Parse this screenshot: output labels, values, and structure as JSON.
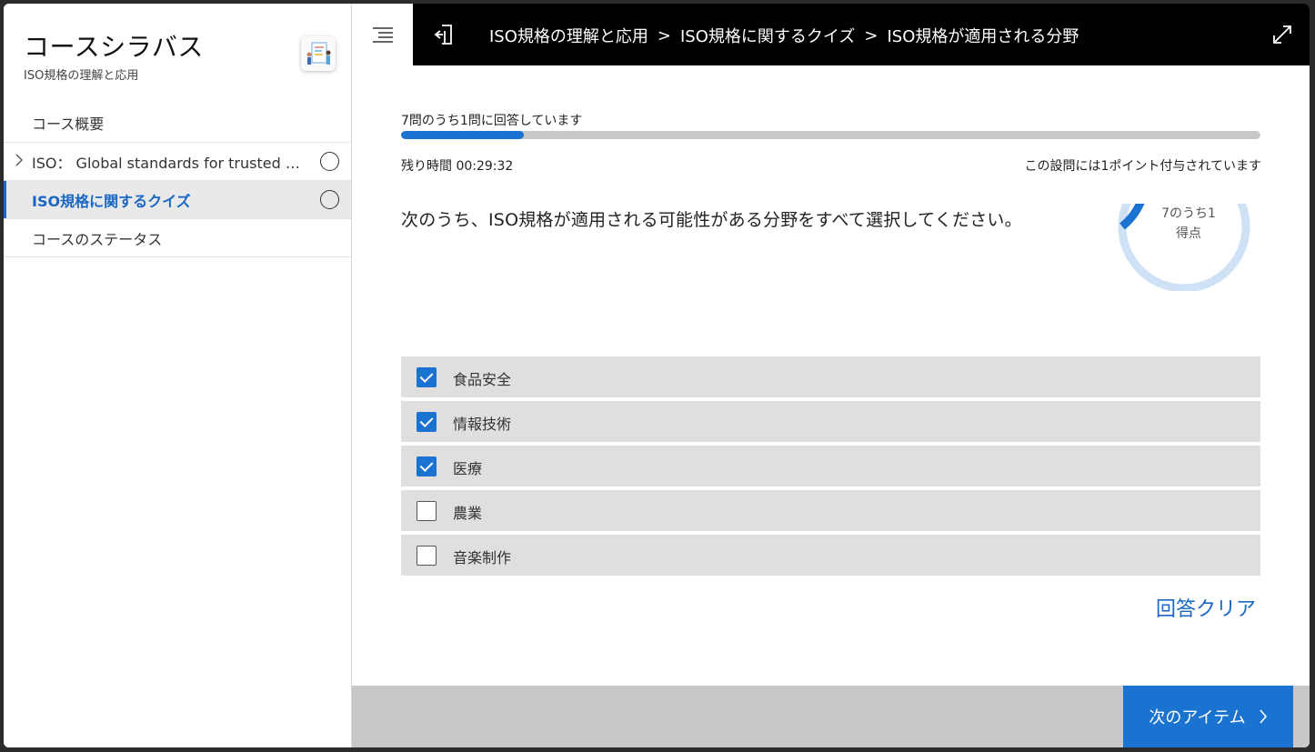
{
  "sidebar": {
    "title": "コースシラバス",
    "subtitle": "ISO規格の理解と応用",
    "thumbnail_icon": "course-illustration-icon",
    "items": [
      {
        "label": "コース概要",
        "has_chevron": false,
        "has_status": false,
        "active": false
      },
      {
        "label": "ISO： Global standards for trusted goods and services",
        "has_chevron": true,
        "has_status": true,
        "active": false
      },
      {
        "label": "ISO規格に関するクイズ",
        "has_chevron": false,
        "has_status": true,
        "active": true
      },
      {
        "label": "コースのステータス",
        "has_chevron": false,
        "has_status": false,
        "active": false
      }
    ]
  },
  "topbar": {
    "menu_icon": "hamburger-menu-icon",
    "exit_icon": "exit-door-icon",
    "breadcrumbs": [
      "ISO規格の理解と応用",
      "ISO規格に関するクイズ",
      "ISO規格が適用される分野"
    ],
    "separator": ">",
    "expand_icon": "expand-icon"
  },
  "quiz": {
    "progress_label": "7問のうち1問に回答しています",
    "progress_fraction": 0.143,
    "time_left": "残り時間 00:29:32",
    "points_note": "この設問には1ポイント付与されています",
    "question": "次のうち、ISO規格が適用される可能性がある分野をすべて選択してください。",
    "score": {
      "line1": "7のうち1",
      "line2": "得点",
      "fraction": 0.143
    },
    "options": [
      {
        "label": "食品安全",
        "checked": true
      },
      {
        "label": "情報技術",
        "checked": true
      },
      {
        "label": "医療",
        "checked": true
      },
      {
        "label": "農業",
        "checked": false
      },
      {
        "label": "音楽制作",
        "checked": false
      }
    ],
    "clear_label": "回答クリア"
  },
  "footer": {
    "next_label": "次のアイテム",
    "next_icon": "chevron-right-icon"
  },
  "colors": {
    "accent": "#1a73d0",
    "link": "#1a67c4",
    "topbar_bg": "#000000",
    "option_bg": "#e0dfde",
    "footer_bg": "#c8c8c8",
    "ring_track": "#cfe2f5"
  }
}
